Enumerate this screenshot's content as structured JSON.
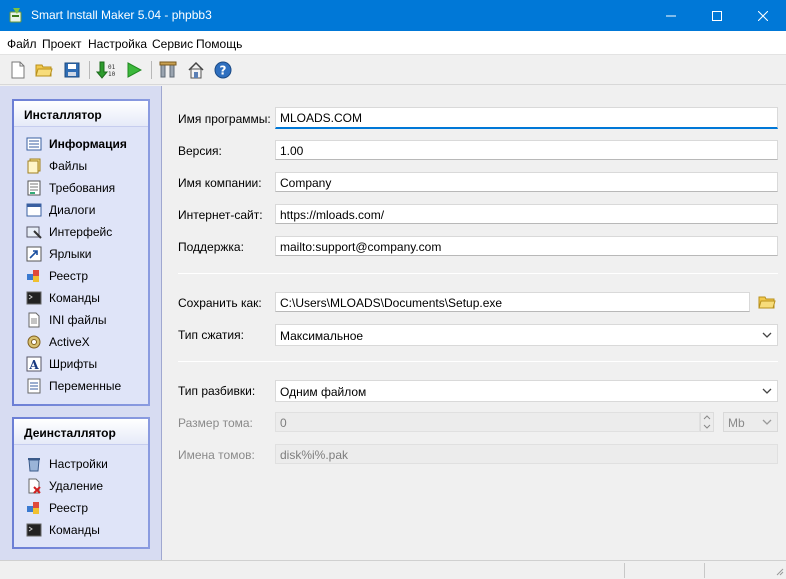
{
  "window": {
    "title": "Smart Install Maker 5.04 - phpbb3"
  },
  "menu": [
    "Файл",
    "Проект",
    "Настройка",
    "Сервис",
    "Помощь"
  ],
  "toolbar": {
    "icons": [
      "new-file-icon",
      "open-folder-icon",
      "save-icon",
      "build-icon",
      "run-icon",
      "settings-icon",
      "home-icon",
      "help-icon"
    ]
  },
  "sidebar": {
    "installer": {
      "title": "Инсталлятор",
      "items": [
        {
          "label": "Информация",
          "icon": "info-list-icon",
          "active": true
        },
        {
          "label": "Файлы",
          "icon": "files-icon"
        },
        {
          "label": "Требования",
          "icon": "requirements-icon"
        },
        {
          "label": "Диалоги",
          "icon": "dialogs-icon"
        },
        {
          "label": "Интерфейс",
          "icon": "interface-icon"
        },
        {
          "label": "Ярлыки",
          "icon": "shortcut-icon"
        },
        {
          "label": "Реестр",
          "icon": "registry-icon"
        },
        {
          "label": "Команды",
          "icon": "commands-icon"
        },
        {
          "label": "INI файлы",
          "icon": "ini-file-icon"
        },
        {
          "label": "ActiveX",
          "icon": "activex-icon"
        },
        {
          "label": "Шрифты",
          "icon": "fonts-icon"
        },
        {
          "label": "Переменные",
          "icon": "variables-icon"
        }
      ]
    },
    "uninstaller": {
      "title": "Деинсталлятор",
      "items": [
        {
          "label": "Настройки",
          "icon": "uninstall-settings-icon"
        },
        {
          "label": "Удаление",
          "icon": "delete-icon"
        },
        {
          "label": "Реестр",
          "icon": "registry-icon"
        },
        {
          "label": "Команды",
          "icon": "commands-icon"
        }
      ]
    }
  },
  "form": {
    "program_name": {
      "label": "Имя программы:",
      "value": "MLOADS.COM"
    },
    "version": {
      "label": "Версия:",
      "value": "1.00"
    },
    "company": {
      "label": "Имя компании:",
      "value": "Company"
    },
    "website": {
      "label": "Интернет-сайт:",
      "value": "https://mloads.com/"
    },
    "support": {
      "label": "Поддержка:",
      "value": "mailto:support@company.com"
    },
    "save_as": {
      "label": "Сохранить как:",
      "value": "C:\\Users\\MLOADS\\Documents\\Setup.exe"
    },
    "compression": {
      "label": "Тип сжатия:",
      "value": "Максимальное"
    },
    "split_type": {
      "label": "Тип разбивки:",
      "value": "Одним файлом"
    },
    "volume_size": {
      "label": "Размер тома:",
      "value": "0",
      "unit": "Mb"
    },
    "volume_names": {
      "label": "Имена томов:",
      "value": "disk%i%.pak"
    }
  },
  "colors": {
    "titlebar": "#0078d7",
    "sidebar_frame": "#6c7fd5",
    "sidebar_bg": "#dfe4f8"
  }
}
